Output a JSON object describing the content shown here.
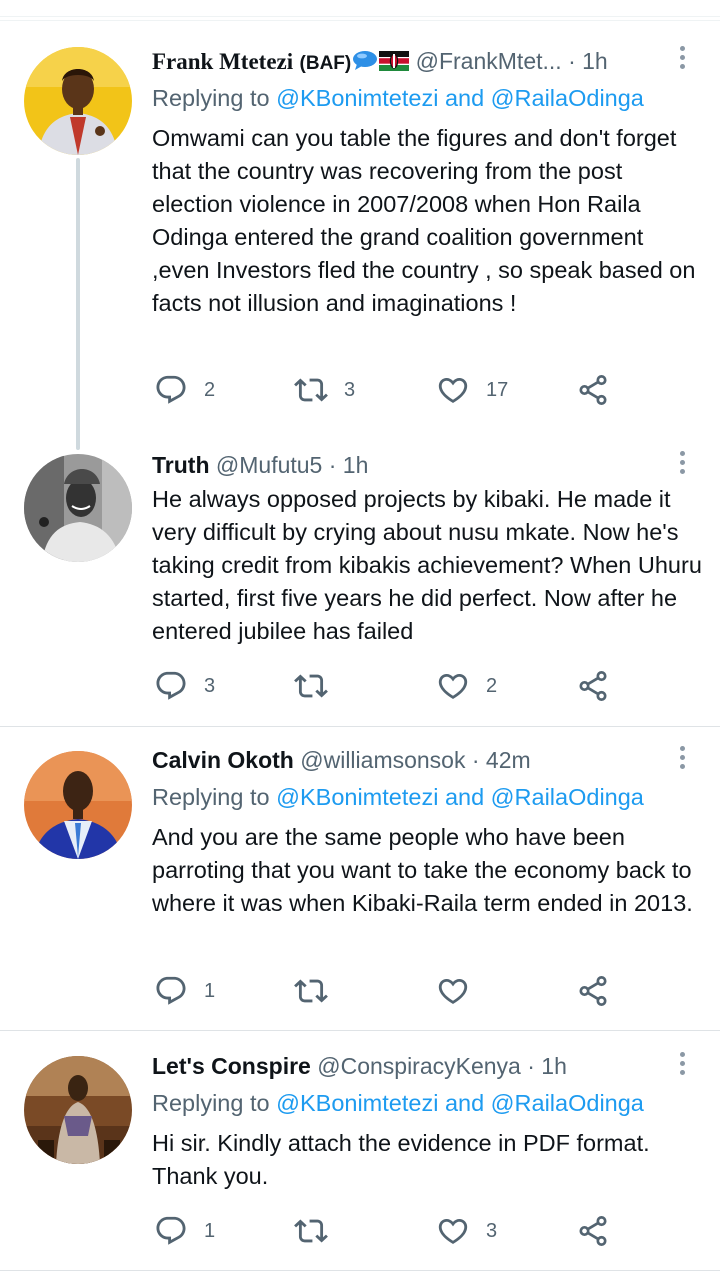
{
  "tweets": [
    {
      "name": "Frank Mtetezi",
      "name_suffix": "(BAF)",
      "handle": "@FrankMtet...",
      "time": "· 1h",
      "replying_prefix": "Replying to ",
      "replying_mentions": "@KBonimtetezi and @RailaOdinga",
      "text": "Omwami can you table the figures and don't forget that the country was recovering from the post election violence in 2007/2008 when Hon Raila Odinga entered the grand coalition government ,even  Investors fled the country , so speak based on facts not illusion and imaginations !",
      "replies": "2",
      "retweets": "3",
      "likes": "17"
    },
    {
      "name": "Truth",
      "handle": "@Mufutu5",
      "time": "· 1h",
      "text": "He always opposed projects by kibaki. He made it very difficult by crying about nusu mkate. Now he's taking credit from kibakis achievement? When Uhuru started, first five years he did perfect. Now after he entered jubilee has failed",
      "replies": "3",
      "retweets": "",
      "likes": "2"
    },
    {
      "name": "Calvin Okoth",
      "handle": "@williamsonsok",
      "time": "· 42m",
      "replying_prefix": "Replying to ",
      "replying_mentions": "@KBonimtetezi and @RailaOdinga",
      "text": "And you are the same people who have been parroting that you want to take the economy back to where it was when Kibaki-Raila term ended in 2013.",
      "replies": "1",
      "retweets": "",
      "likes": ""
    },
    {
      "name": "Let's Conspire",
      "handle": "@ConspiracyKenya",
      "time": "· 1h",
      "replying_prefix": "Replying to ",
      "replying_mentions": "@KBonimtetezi and @RailaOdinga",
      "text": "Hi sir. Kindly attach the evidence in PDF format. Thank you.",
      "replies": "1",
      "retweets": "",
      "likes": "3"
    }
  ],
  "icons": {
    "reply": "reply-icon",
    "retweet": "retweet-icon",
    "like": "heart-icon",
    "share": "share-icon",
    "more": "more-vertical-icon",
    "speech": "speech-bubble-emoji",
    "flag": "kenya-flag-emoji"
  },
  "colors": {
    "accent": "#1d9bf0",
    "secondary_text": "#536471",
    "icon": "#536471",
    "divider": "#dfe3e6",
    "thread_line": "#cfd9de"
  }
}
